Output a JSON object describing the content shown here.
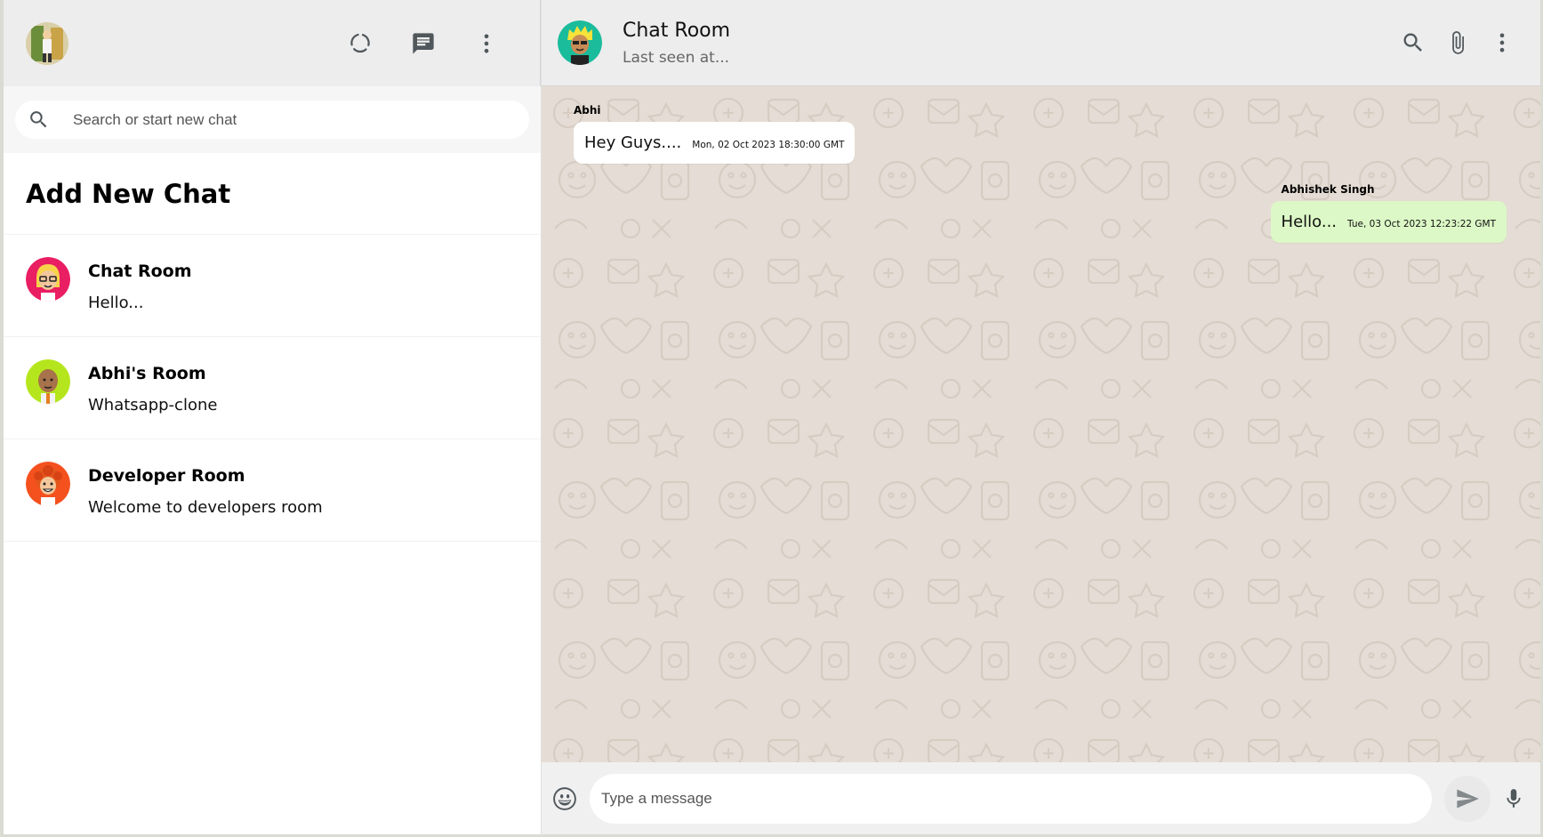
{
  "sidebar": {
    "icons": [
      "status-icon",
      "new-chat-icon",
      "more-vert-icon"
    ],
    "search_placeholder": "Search or start new chat",
    "add_new_chat": "Add New Chat",
    "rooms": [
      {
        "name": "Chat Room",
        "last_message": "Hello...",
        "avatar_color": "#e91e63"
      },
      {
        "name": "Abhi's Room",
        "last_message": "Whatsapp-clone",
        "avatar_color": "#b5e61d"
      },
      {
        "name": "Developer Room",
        "last_message": "Welcome to developers room",
        "avatar_color": "#f4511e"
      }
    ]
  },
  "chat": {
    "title": "Chat Room",
    "subtitle": "Last seen at...",
    "header_icons": [
      "search-icon",
      "attach-icon",
      "more-vert-icon"
    ],
    "messages": [
      {
        "sender": "Abhi",
        "text": "Hey Guys....",
        "time": "Mon, 02 Oct 2023 18:30:00 GMT",
        "sent": false
      },
      {
        "sender": "Abhishek Singh",
        "text": "Hello...",
        "time": "Tue, 03 Oct 2023 12:23:22 GMT",
        "sent": true
      }
    ],
    "input_placeholder": "Type a message"
  },
  "colors": {
    "header_bg": "#ededed",
    "chat_bg": "#e5ddd5",
    "sent_bubble": "#dcf8c6",
    "received_bubble": "#ffffff"
  }
}
